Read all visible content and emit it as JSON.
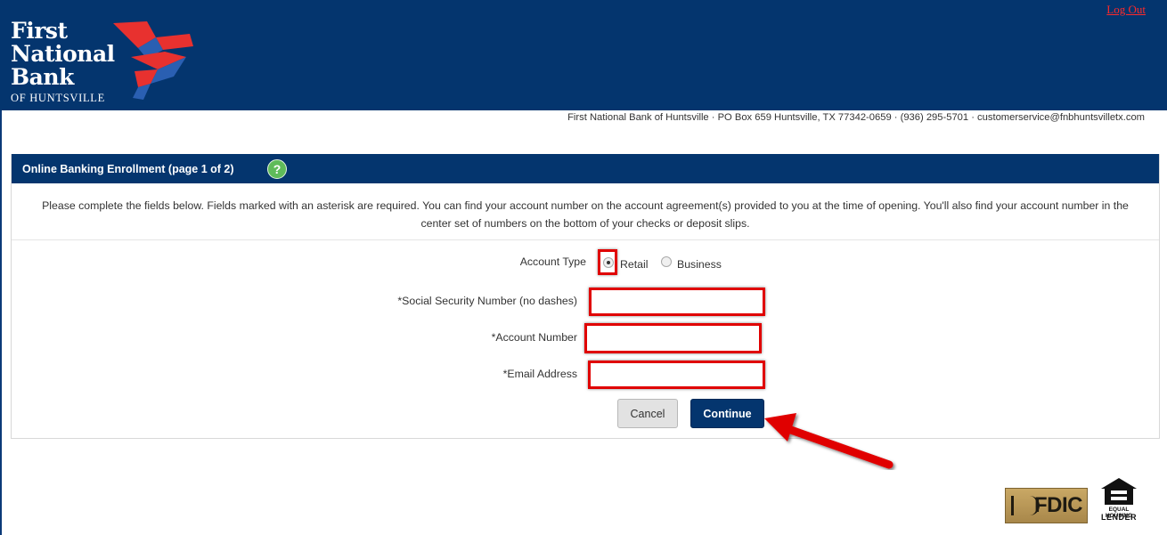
{
  "header": {
    "logo": {
      "line1": "First",
      "line2": "National",
      "line3": "Bank",
      "line4": "OF HUNTSVILLE"
    },
    "logout_label": "Log Out",
    "colors": {
      "navy": "#04356e",
      "accent_red": "#e8312f",
      "accent_blue": "#2a5fb2"
    }
  },
  "contact_line": "First National Bank of Huntsville · PO Box 659 Huntsville, TX 77342-0659 · (936) 295-5701 · customerservice@fnbhuntsvilletx.com",
  "panel": {
    "title": "Online Banking Enrollment (page 1 of 2)",
    "help_icon": "question-mark-icon",
    "intro_line1": "Please complete the fields below. Fields marked with an asterisk are required. You can find your account number on the account agreement(s) provided to you at the time of opening. You'll also find your account number in the",
    "intro_line2": "center set of numbers on the bottom of your checks or deposit slips."
  },
  "form": {
    "account_type_label": "Account Type",
    "options": [
      {
        "label": "Retail",
        "selected": true
      },
      {
        "label": "Business",
        "selected": false
      }
    ],
    "ssn_label": "*Social Security Number (no dashes)",
    "ssn_value": "",
    "account_number_label": "*Account Number",
    "account_number_value": "",
    "email_label": "*Email Address",
    "email_value": "",
    "cancel_label": "Cancel",
    "continue_label": "Continue"
  },
  "footer": {
    "fdic_label": "FDIC",
    "ehl_line1": "EQUAL HOUSING",
    "ehl_line2": "LENDER"
  }
}
